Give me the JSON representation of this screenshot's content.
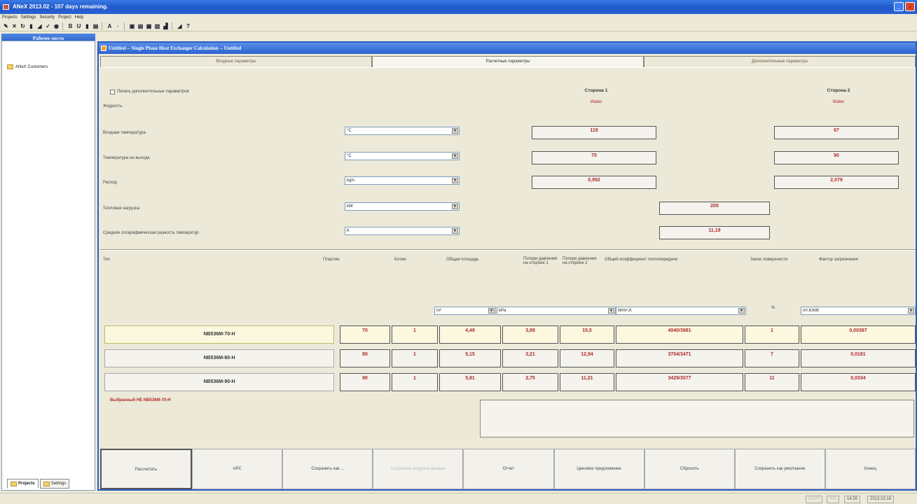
{
  "app": {
    "title": "ANeX 2013.02  -  107 days remaining.",
    "window_buttons": [
      "_",
      "x"
    ]
  },
  "menu": [
    "Projects",
    "Settings",
    "Security",
    "Project",
    "Help"
  ],
  "toolbar": {
    "buttons": [
      "✎",
      "✕",
      "↻",
      "▮",
      "◢",
      "✓",
      "◉",
      "|",
      "B",
      "U",
      "▮",
      "▤",
      "|",
      "A",
      "·",
      "|",
      "▣",
      "▤",
      "▦",
      "▥",
      "▟",
      "|",
      "◢",
      "?"
    ]
  },
  "left_panel": {
    "header": "Рабочее место",
    "tree_item": "ANeX Customers",
    "tabs": [
      "Projects",
      "Settings"
    ]
  },
  "child_window": {
    "title": "Untitled -- Single Phase Heat Exchanger Calculation -- Untitled",
    "tabs": [
      "Входные параметры",
      "Расчетные параметры",
      "Дополнительные параметры"
    ]
  },
  "form": {
    "print_checkbox_label": "Печать дополнительных параметров",
    "fluid_label": "Жидкость",
    "side1_header": "Сторона 1",
    "side2_header": "Сторона 2",
    "side1_fluid": "Water",
    "side2_fluid": "Water",
    "rows": [
      {
        "label": "Входная температура",
        "unit": "°C",
        "side1": "118",
        "side2": "67"
      },
      {
        "label": "Температура на выходе",
        "unit": "°C",
        "side1": "70",
        "side2": "90"
      },
      {
        "label": "Расход",
        "unit": "kg/s",
        "side1": "0,992",
        "side2": "2,079"
      },
      {
        "label": "Тепловая нагрузка",
        "unit": "kW",
        "value": "200"
      },
      {
        "label": "Средняя логарифмическая разность температур",
        "unit": "K",
        "value": "11,19"
      }
    ]
  },
  "results": {
    "columns": [
      "Тип",
      "Пластин",
      "Блоки",
      "Общая площадь",
      "Потери давления на стороне 1",
      "Потери давления на стороне 2",
      "Общий коэффициент теплопередачи",
      "Запас поверхности",
      "Фактор загрязнения"
    ],
    "units": {
      "area": "m²",
      "pressure": "kPa",
      "coef": "W/m²,K",
      "margin": "%",
      "fouling": "m²,K/kW"
    },
    "rows": [
      {
        "type": "NB536M-70-H",
        "plates": "70",
        "blocks": "1",
        "area": "4,49",
        "dp1": "3,89",
        "dp2": "15,5",
        "coef": "4040/3981",
        "margin": "1",
        "fouling": "0,00367"
      },
      {
        "type": "NB536M-80-H",
        "plates": "80",
        "blocks": "1",
        "area": "5,15",
        "dp1": "3,21",
        "dp2": "12,94",
        "coef": "3704/3471",
        "margin": "7",
        "fouling": "0,0181"
      },
      {
        "type": "NB536M-90-H",
        "plates": "90",
        "blocks": "1",
        "area": "5,81",
        "dp1": "2,75",
        "dp2": "11,21",
        "coef": "3429/3077",
        "margin": "11",
        "fouling": "0,0334"
      }
    ],
    "selected_text": "Выбранный НЕ NB536M-70-H"
  },
  "buttons": [
    "Рассчитать",
    "APC",
    "Сохранить как ...",
    "Сохранить входные данные",
    "Отчет",
    "Ценовое предложение",
    "Сбросить",
    "Сохранить как умолчание",
    "Конец"
  ],
  "status": {
    "caps": "CAPS",
    "ins": "INS",
    "time": "14:35",
    "date": "2013.10.16"
  }
}
